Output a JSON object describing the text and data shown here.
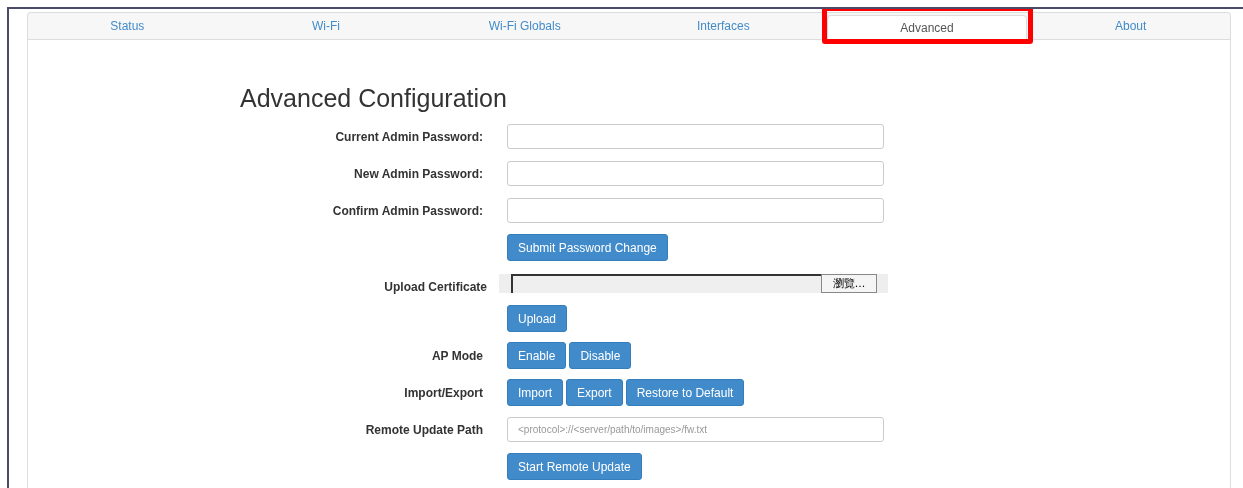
{
  "tabs": [
    {
      "label": "Status",
      "selected": false,
      "highlighted": false
    },
    {
      "label": "Wi-Fi",
      "selected": false,
      "highlighted": false
    },
    {
      "label": "Wi-Fi Globals",
      "selected": false,
      "highlighted": false
    },
    {
      "label": "Interfaces",
      "selected": false,
      "highlighted": false
    },
    {
      "label": "Advanced",
      "selected": true,
      "highlighted": true
    },
    {
      "label": "About",
      "selected": false,
      "highlighted": false
    }
  ],
  "heading": "Advanced Configuration",
  "rows": [
    {
      "kind": "field",
      "label": "Current Admin Password:"
    },
    {
      "kind": "field",
      "label": "New Admin Password:"
    },
    {
      "kind": "field",
      "label": "Confirm Admin Password:"
    },
    {
      "kind": "buttons",
      "buttons": [
        "Submit Password Change"
      ]
    },
    {
      "kind": "file",
      "label": "Upload Certificate",
      "browse": "瀏覽..."
    },
    {
      "kind": "buttons",
      "buttons": [
        "Upload"
      ]
    },
    {
      "kind": "buttons",
      "label": "AP Mode",
      "buttons": [
        "Enable",
        "Disable"
      ]
    },
    {
      "kind": "buttons",
      "label": "Import/Export",
      "buttons": [
        "Import",
        "Export",
        "Restore to Default"
      ]
    },
    {
      "kind": "field",
      "label": "Remote Update Path",
      "placeholder": "<protocol>://<server/path/to/images>/fw.txt"
    },
    {
      "kind": "buttons",
      "buttons": [
        "Start Remote Update"
      ]
    }
  ]
}
